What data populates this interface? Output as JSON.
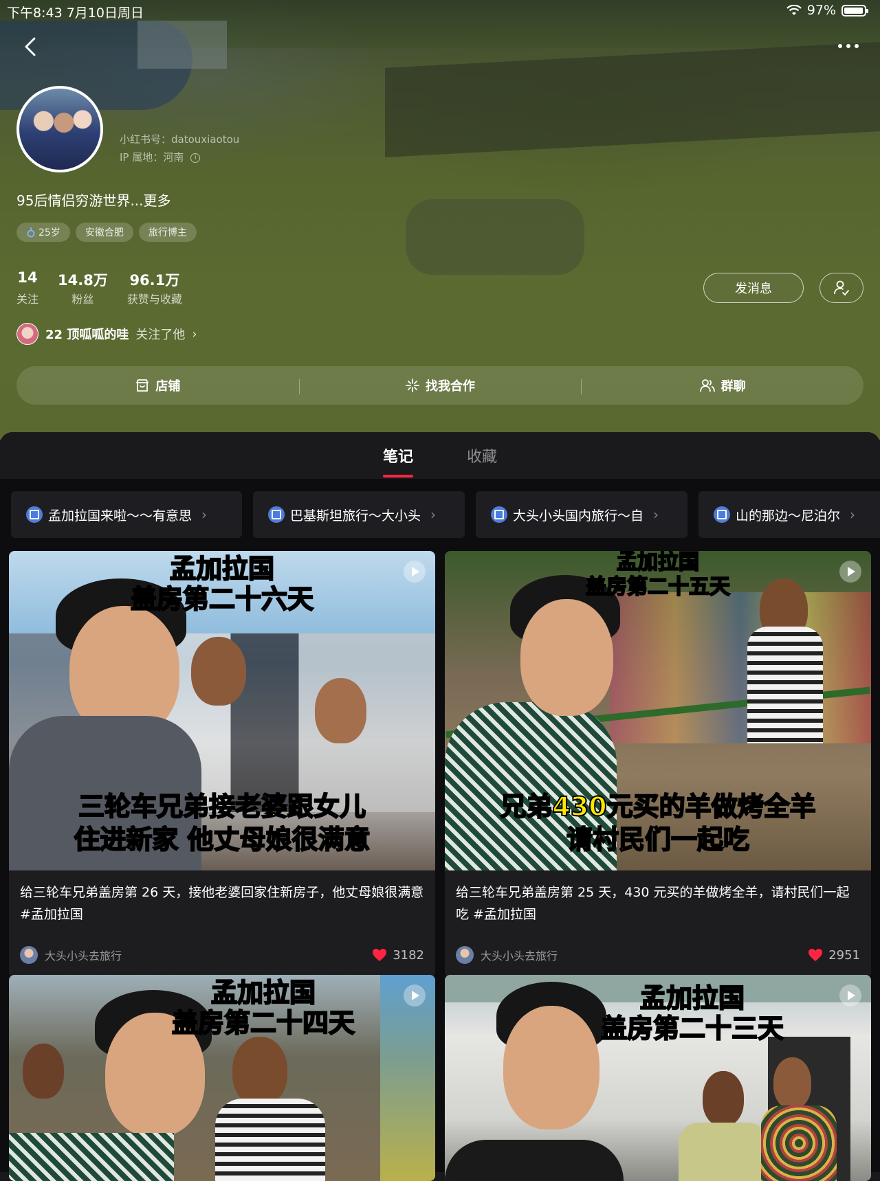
{
  "status_bar": {
    "time_date": "下午8:43   7月10日周日",
    "battery": "97%",
    "battery_level": 0.97
  },
  "profile": {
    "account_id": "小红书号：datouxiaotou",
    "ip_location": "IP 属地：河南",
    "bio": "95后情侣穷游世界...更多",
    "tags": [
      "25岁",
      "安徽合肥",
      "旅行博主"
    ],
    "stats": [
      {
        "num": "14",
        "label": "关注"
      },
      {
        "num": "14.8万",
        "label": "粉丝"
      },
      {
        "num": "96.1万",
        "label": "获赞与收藏"
      }
    ],
    "message_button": "发消息",
    "followed_by": {
      "name": "22 顶呱呱的哇",
      "action": "关注了他",
      "chevron": "›"
    },
    "actions": [
      "店铺",
      "找我合作",
      "群聊"
    ]
  },
  "tabs": [
    "笔记",
    "收藏"
  ],
  "collections": [
    "孟加拉国来啦～～有意思",
    "巴基斯坦旅行～大小头",
    "大头小头国内旅行～自",
    "山的那边～尼泊尔"
  ],
  "collection_chevron": "›",
  "notes": [
    {
      "banner_top1": "孟加拉国",
      "banner_top2": "盖房第二十六天",
      "banner_bot1": "三轮车兄弟接老婆跟女儿",
      "banner_bot2": "住进新家 他丈母娘很满意",
      "caption": "给三轮车兄弟盖房第 26 天，接他老婆回家住新房子，他丈母娘很满意 #孟加拉国",
      "author": "大头小头去旅行",
      "likes": "3182"
    },
    {
      "banner_top1": "孟加拉国",
      "banner_top2": "盖房第二十五天",
      "banner_bot1": "兄弟430元买的羊做烤全羊",
      "banner_bot2": "请村民们一起吃",
      "caption": "给三轮车兄弟盖房第 25 天，430 元买的羊做烤全羊，请村民们一起吃 #孟加拉国",
      "author": "大头小头去旅行",
      "likes": "2951"
    },
    {
      "banner_top1": "孟加拉国",
      "banner_top2": "盖房第二十四天"
    },
    {
      "banner_top1": "孟加拉国",
      "banner_top2": "盖房第二十三天"
    }
  ],
  "colors": {
    "accent": "#ff2442",
    "banner_yellow": "#ffe600",
    "banner_red": "#ff1f1f",
    "header_bg": "#56652f"
  }
}
